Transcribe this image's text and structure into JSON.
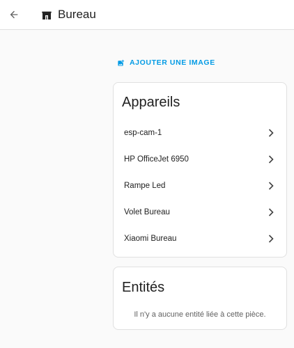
{
  "header": {
    "title": "Bureau",
    "back_icon": "arrow-left-icon",
    "room_icon": "door-icon"
  },
  "actions": {
    "add_image_label": "AJOUTER UNE IMAGE",
    "add_image_icon": "image-plus-icon"
  },
  "devices_card": {
    "title": "Appareils",
    "items": [
      {
        "label": "esp-cam-1"
      },
      {
        "label": "HP OfficeJet 6950"
      },
      {
        "label": "Rampe Led"
      },
      {
        "label": "Volet Bureau"
      },
      {
        "label": "Xiaomi Bureau"
      }
    ]
  },
  "entities_card": {
    "title": "Entités",
    "empty_message": "Il n'y a aucune entité liée à cette pièce."
  },
  "colors": {
    "accent": "#039be5",
    "background": "#fafafa",
    "card": "#ffffff",
    "text": "#212121"
  }
}
